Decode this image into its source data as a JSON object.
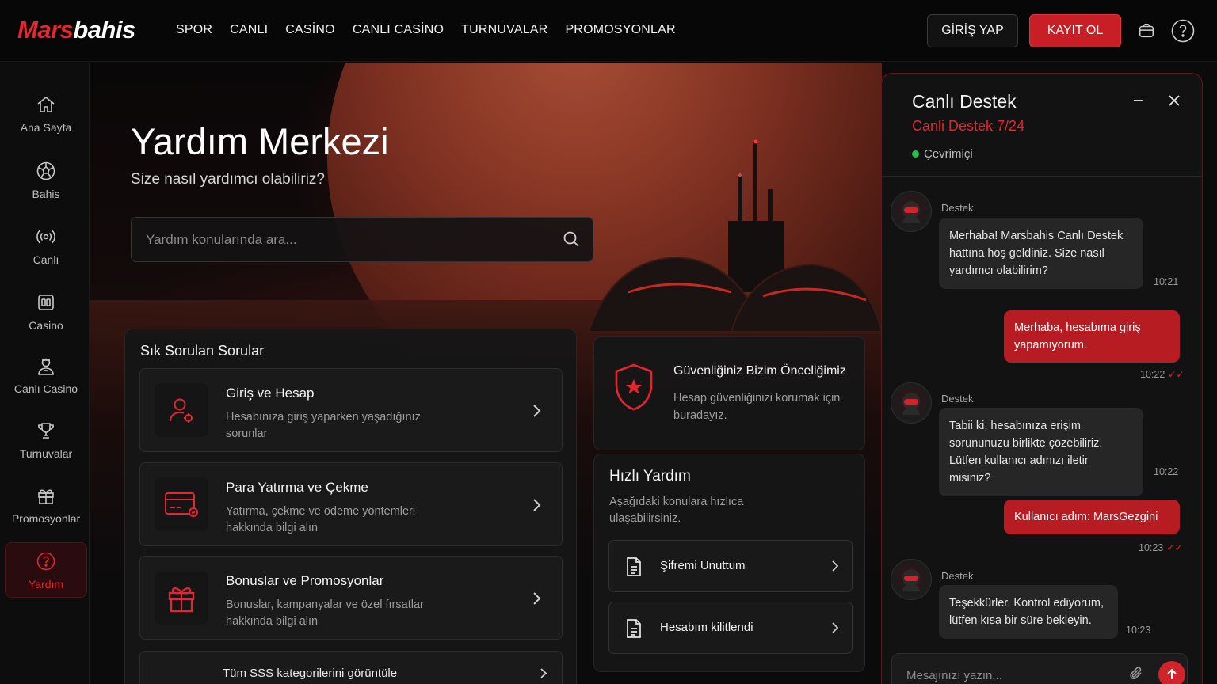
{
  "brand": {
    "logo_part1": "Mars",
    "logo_part2": "bahis",
    "accent_color": "#e3262f"
  },
  "nav": {
    "items": [
      {
        "label": "SPOR"
      },
      {
        "label": "CANLI"
      },
      {
        "label": "CASİNO"
      },
      {
        "label": "CANLI CASİNO"
      },
      {
        "label": "TURNUVALAR"
      },
      {
        "label": "PROMOSYONLAR"
      }
    ],
    "login_label": "GİRİŞ YAP",
    "register_label": "KAYIT OL",
    "icons": [
      "wallet-icon",
      "help-icon"
    ]
  },
  "sidebar": {
    "items": [
      {
        "label": "Ana Sayfa",
        "icon": "home-icon"
      },
      {
        "label": "Bahis",
        "icon": "soccer-ball-icon"
      },
      {
        "label": "Canlı",
        "icon": "broadcast-icon"
      },
      {
        "label": "Casino",
        "icon": "dice-icon"
      },
      {
        "label": "Canlı Casino",
        "icon": "dealer-icon"
      },
      {
        "label": "Turnuvalar",
        "icon": "trophy-icon"
      },
      {
        "label": "Promosyonlar",
        "icon": "gift-icon"
      },
      {
        "label": "Yardım",
        "icon": "help-icon",
        "active": true
      }
    ]
  },
  "hero": {
    "title": "Yardım Merkezi",
    "subtitle": "Size nasıl yardımcı olabiliriz?",
    "search_placeholder": "Yardım konularında ara..."
  },
  "faq": {
    "title": "Sık Sorulan Sorular",
    "items": [
      {
        "title": "Giriş ve Hesap",
        "desc": "Hesabınıza giriş yaparken yaşadığınız sorunlar",
        "icon": "user-settings-icon"
      },
      {
        "title": "Para Yatırma ve Çekme",
        "desc": "Yatırma, çekme ve ödeme yöntemleri hakkında bilgi alın",
        "icon": "credit-card-icon"
      },
      {
        "title": "Bonuslar ve Promosyonlar",
        "desc": "Bonuslar, kampanyalar ve özel fırsatlar hakkında bilgi alın",
        "icon": "gift-icon"
      }
    ],
    "all_label": "Tüm SSS kategorilerini görüntüle"
  },
  "security": {
    "title": "Güvenliğiniz Bizim Önceliğimiz",
    "desc": "Hesap güvenliğinizi korumak için buradayız.",
    "icon": "shield-icon"
  },
  "quick_help": {
    "title": "Hızlı Yardım",
    "desc": "Aşağıdaki konulara hızlıca ulaşabilirsiniz.",
    "items": [
      {
        "label": "Şifremi Unuttum",
        "icon": "document-icon"
      },
      {
        "label": "Hesabım kilitlendi",
        "icon": "document-icon"
      }
    ]
  },
  "chat": {
    "title": "Canlı Destek",
    "subtitle": "Canli Destek 7/24",
    "status": "Çevrimiçi",
    "status_color": "#21c04a",
    "messages": [
      {
        "from": "agent",
        "sender": "Destek",
        "text": "Merhaba! Marsbahis Canlı Destek hattına hoş geldiniz. Size nasıl yardımcı olabilirim?",
        "time": "10:21"
      },
      {
        "from": "user",
        "text": "Merhaba, hesabıma giriş yapamıyorum.",
        "time": "10:22"
      },
      {
        "from": "agent",
        "sender": "Destek",
        "text": "Tabii ki, hesabınıza erişim sorununuzu birlikte çözebiliriz. Lütfen kullanıcı adınızı iletir misiniz?",
        "time": "10:22"
      },
      {
        "from": "user",
        "text": "Kullanıcı adım: MarsGezgini",
        "time": "10:23"
      },
      {
        "from": "agent",
        "sender": "Destek",
        "text": "Teşekkürler. Kontrol ediyorum, lütfen kısa bir süre bekleyin.",
        "time": "10:23"
      }
    ],
    "input_placeholder": "Mesajınızı yazın..."
  }
}
